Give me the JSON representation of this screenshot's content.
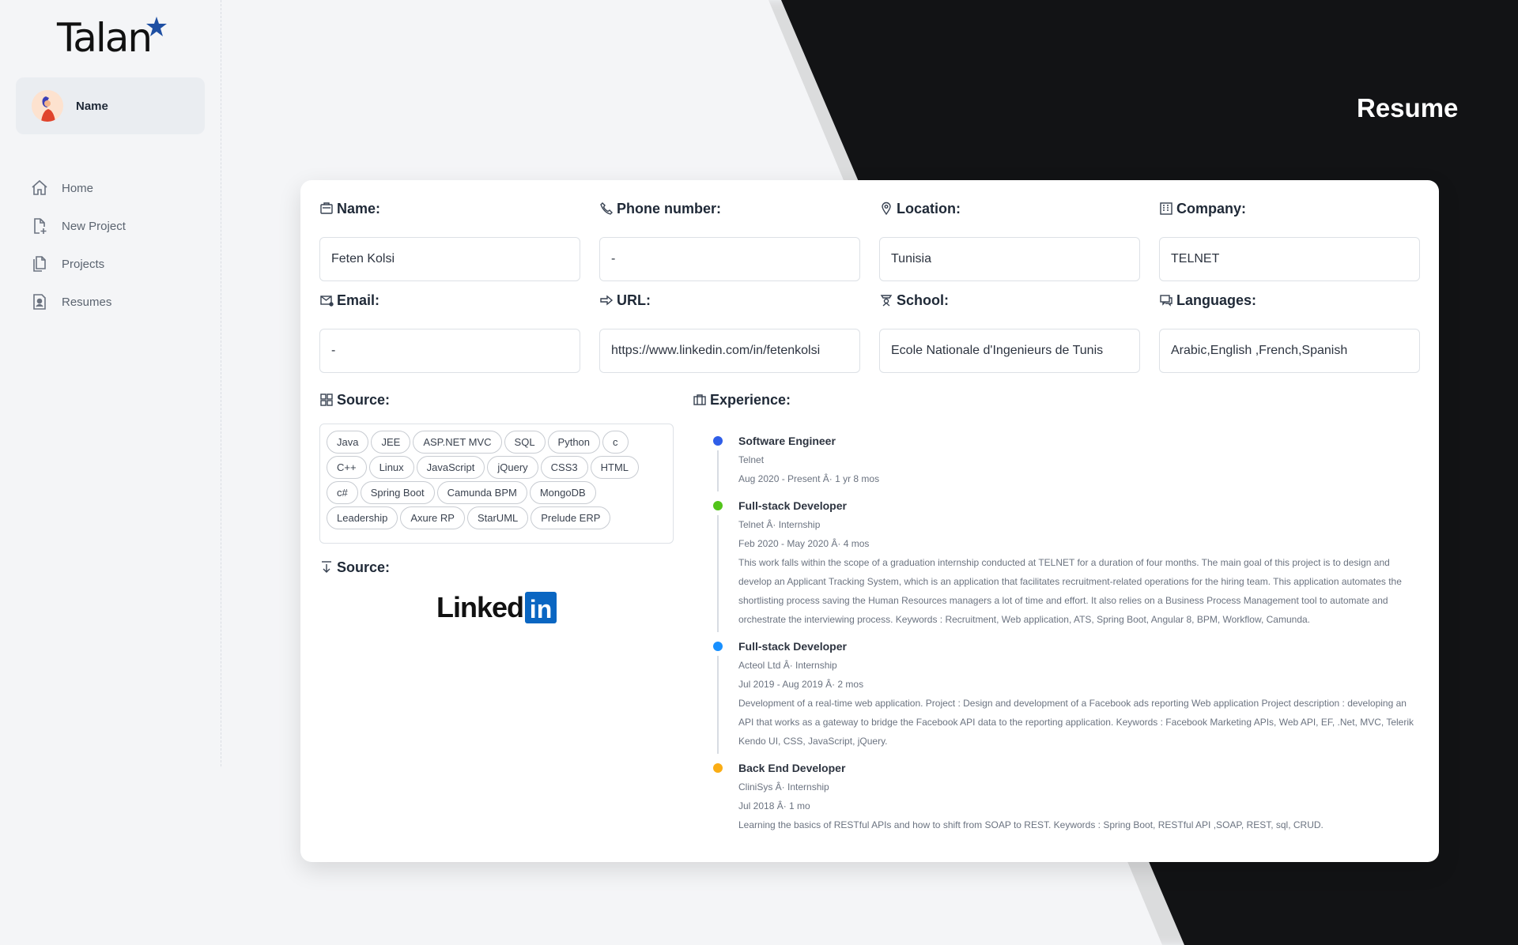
{
  "app": {
    "logo": "Talan",
    "brand_color": "#1e4fa3"
  },
  "sidebar": {
    "user_name": "Name",
    "items": [
      {
        "label": "Home",
        "icon": "home-icon"
      },
      {
        "label": "New Project",
        "icon": "file-plus-icon"
      },
      {
        "label": "Projects",
        "icon": "files-icon"
      },
      {
        "label": "Resumes",
        "icon": "resume-icon"
      }
    ]
  },
  "header": {
    "title": "Resume"
  },
  "fields": {
    "name": {
      "label": "Name:",
      "value": "Feten Kolsi"
    },
    "phone": {
      "label": "Phone number:",
      "value": "-"
    },
    "location": {
      "label": "Location:",
      "value": "Tunisia"
    },
    "company": {
      "label": "Company:",
      "value": "TELNET"
    },
    "email": {
      "label": "Email:",
      "value": "-"
    },
    "url": {
      "label": "URL:",
      "value": "https://www.linkedin.com/in/fetenkolsi"
    },
    "school": {
      "label": "School:",
      "value": "Ecole Nationale d'Ingenieurs de Tunis"
    },
    "languages": {
      "label": "Languages:",
      "value": "Arabic,English ,French,Spanish"
    }
  },
  "skills_section": {
    "label": "Source:",
    "skills": [
      "Java",
      "JEE",
      "ASP.NET MVC",
      "SQL",
      "Python",
      "c",
      "C++",
      "Linux",
      "JavaScript",
      "jQuery",
      "CSS3",
      "HTML",
      "c#",
      "Spring Boot",
      "Camunda BPM",
      "MongoDB",
      "Leadership",
      "Axure RP",
      "StarUML",
      "Prelude ERP"
    ]
  },
  "source_section": {
    "label": "Source:",
    "logo": "LinkedIn"
  },
  "experience_section": {
    "label": "Experience:",
    "items": [
      {
        "title": "Software Engineer",
        "company": "Telnet",
        "dates": "Aug 2020 - Present Â· 1 yr 8 mos",
        "description": "",
        "dot_color": "#2f5ee8"
      },
      {
        "title": "Full-stack Developer",
        "company": "Telnet Â· Internship",
        "dates": "Feb 2020 - May 2020 Â· 4 mos",
        "description": "This work falls within the scope of a graduation internship conducted at TELNET for a duration of four months. The main goal of this project is to design and develop an Applicant Tracking System, which is an application that facilitates recruitment-related operations for the hiring team. This application automates the shortlisting process saving the Human Resources managers a lot of time and effort. It also relies on a Business Process Management tool to automate and orchestrate the interviewing process. Keywords : Recruitment, Web application, ATS, Spring Boot, Angular 8, BPM, Workflow, Camunda.",
        "dot_color": "#52c41a"
      },
      {
        "title": "Full-stack Developer",
        "company": "Acteol Ltd Â· Internship",
        "dates": "Jul 2019 - Aug 2019 Â· 2 mos",
        "description": "Development of a real-time web application. Project : Design and development of a Facebook ads reporting Web application Project description : developing an API that works as a gateway to bridge the Facebook API data to the reporting application. Keywords : Facebook Marketing APIs, Web API, EF, .Net, MVC, Telerik Kendo UI, CSS, JavaScript, jQuery.",
        "dot_color": "#1890ff"
      },
      {
        "title": "Back End Developer",
        "company": "CliniSys Â· Internship",
        "dates": "Jul 2018 Â· 1 mo",
        "description": "Learning the basics of RESTful APIs and how to shift from SOAP to REST. Keywords : Spring Boot, RESTful API ,SOAP, REST, sql, CRUD.",
        "dot_color": "#faad14"
      }
    ]
  }
}
